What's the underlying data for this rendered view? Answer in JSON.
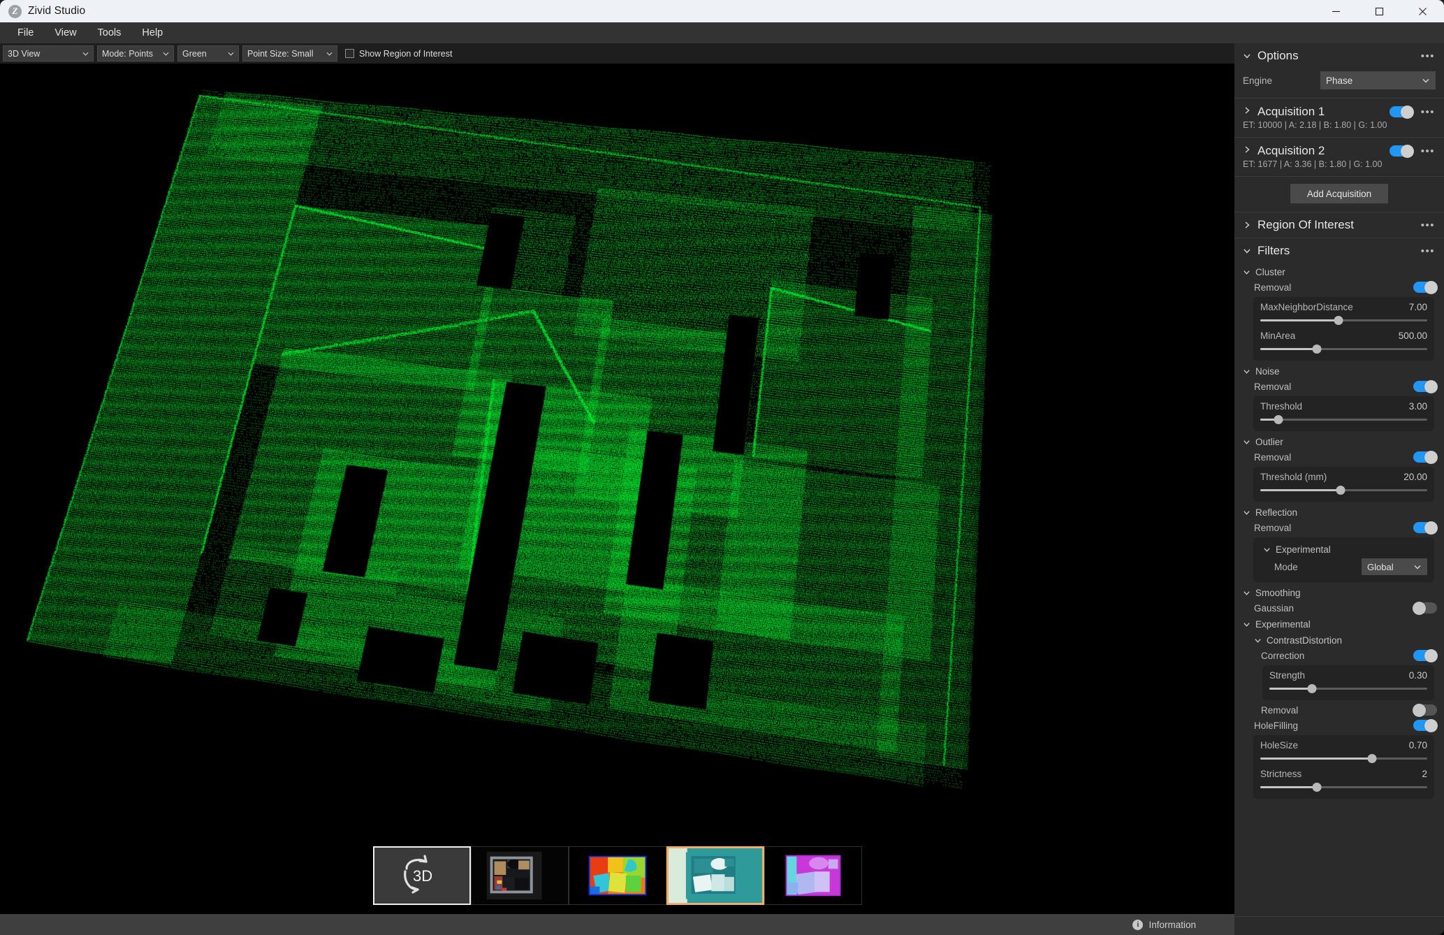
{
  "window": {
    "title": "Zivid Studio",
    "logo_letter": "Z",
    "minimize_icon": "minimize-icon",
    "maximize_icon": "maximize-icon",
    "close_icon": "close-icon"
  },
  "menubar": {
    "items": [
      "File",
      "View",
      "Tools",
      "Help"
    ]
  },
  "toolbar": {
    "view_mode": "3D View",
    "render_mode": "Mode: Points",
    "color_mode": "Green",
    "point_size": "Point Size: Small",
    "roi_checkbox_label": "Show Region of Interest",
    "roi_checked": false
  },
  "options": {
    "title": "Options",
    "caret": "chevron-down",
    "menu_dots": "•••",
    "engine_label": "Engine",
    "engine_value": "Phase"
  },
  "acquisitions": [
    {
      "title": "Acquisition 1",
      "caret": "chevron-right",
      "enabled": true,
      "params": "ET: 10000  |  A: 2.18  |  B: 1.80  |  G: 1.00"
    },
    {
      "title": "Acquisition 2",
      "caret": "chevron-right",
      "enabled": true,
      "params": "ET: 1677  |  A: 3.36  |  B: 1.80  |  G: 1.00"
    }
  ],
  "add_acquisition_label": "Add Acquisition",
  "region_of_interest": {
    "title": "Region Of Interest",
    "caret": "chevron-right",
    "expanded": false
  },
  "filters": {
    "title": "Filters",
    "caret": "chevron-down",
    "groups": [
      {
        "name": "Cluster",
        "toggle_label": "Removal",
        "toggle_on": true,
        "params": [
          {
            "name": "MaxNeighborDistance",
            "value": "7.00",
            "pct": 47
          },
          {
            "name": "MinArea",
            "value": "500.00",
            "pct": 34
          }
        ]
      },
      {
        "name": "Noise",
        "toggle_label": "Removal",
        "toggle_on": true,
        "params": [
          {
            "name": "Threshold",
            "value": "3.00",
            "pct": 11
          }
        ]
      },
      {
        "name": "Outlier",
        "toggle_label": "Removal",
        "toggle_on": true,
        "params": [
          {
            "name": "Threshold (mm)",
            "value": "20.00",
            "pct": 48
          }
        ]
      },
      {
        "name": "Reflection",
        "toggle_label": "Removal",
        "toggle_on": true,
        "sub": {
          "name": "Experimental",
          "mode_label": "Mode",
          "mode_value": "Global"
        }
      },
      {
        "name": "Smoothing",
        "toggle_label": "Gaussian",
        "toggle_on": false
      }
    ],
    "experimental": {
      "name": "Experimental",
      "contrast_distortion": {
        "name": "ContrastDistortion",
        "correction_label": "Correction",
        "correction_on": true,
        "strength": {
          "name": "Strength",
          "value": "0.30",
          "pct": 27
        },
        "removal_label": "Removal",
        "removal_on": false
      },
      "hole_filling": {
        "name": "HoleFilling",
        "on": true,
        "params": [
          {
            "name": "HoleSize",
            "value": "0.70",
            "pct": 67
          },
          {
            "name": "Strictness",
            "value": "2",
            "pct": 34
          }
        ]
      }
    }
  },
  "thumbnails": [
    {
      "name": "3d-view-thumbnail",
      "label": "3D",
      "type": "icon3d",
      "selected": true
    },
    {
      "name": "rgb-thumbnail",
      "label": "",
      "type": "rgb",
      "selected": false
    },
    {
      "name": "depth-thumbnail",
      "label": "",
      "type": "depth",
      "selected": false
    },
    {
      "name": "snr-thumbnail",
      "label": "",
      "type": "snr",
      "selected": true
    },
    {
      "name": "normals-thumbnail",
      "label": "",
      "type": "normals",
      "selected": false
    }
  ],
  "statusbar": {
    "info_icon": "info-icon",
    "text": "Information"
  },
  "colors": {
    "accent": "#2196f3",
    "point_cloud": "#00e831",
    "panel_bg": "#2b2b2b",
    "card_bg": "#232323",
    "selection_orange": "#f0ad6a",
    "titlebar_bg": "#eef1f5"
  }
}
